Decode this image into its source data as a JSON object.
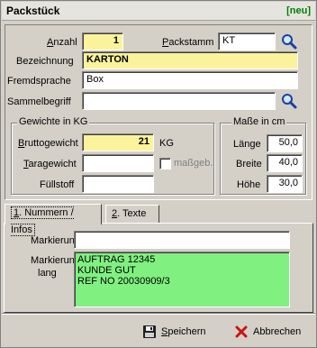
{
  "window": {
    "title": "Packstück",
    "badge": "[neu]",
    "badge_color": "#008000"
  },
  "main": {
    "anzahl": {
      "label_u": "A",
      "label_rest": "nzahl",
      "value": "1"
    },
    "packstamm": {
      "label_u": "P",
      "label_rest": "ackstamm",
      "value": "KT"
    },
    "bezeichnung": {
      "label": "Bezeichnung",
      "value": "KARTON"
    },
    "fremdsprache": {
      "label": "Fremdsprache",
      "value": "Box"
    },
    "sammelbegriff": {
      "label": "Sammelbegriff",
      "value": ""
    }
  },
  "weights": {
    "title": "Gewichte in KG",
    "brutto": {
      "label_u": "B",
      "label_rest": "ruttogewicht",
      "value": "21",
      "unit": "KG"
    },
    "tara": {
      "label_u": "T",
      "label_rest": "aragewicht",
      "value": ""
    },
    "tara_checkbox_label": "maßgeb.",
    "fuellstoff": {
      "label": "Füllstoff",
      "value": ""
    }
  },
  "dimensions": {
    "title": "Maße in cm",
    "laenge": {
      "label": "Länge",
      "value": "50,0"
    },
    "breite": {
      "label": "Breite",
      "value": "40,0"
    },
    "hoehe": {
      "label": "Höhe",
      "value": "30,0"
    }
  },
  "tabs": [
    {
      "label_u": "1",
      "label_rest": ". Nummern / Infos"
    },
    {
      "label_u": "2",
      "label_rest": ". Texte"
    }
  ],
  "tab_content": {
    "markierung": {
      "label": "Markierung",
      "value": ""
    },
    "markierung_lang": {
      "label_line1": "Markierung",
      "label_line2": "lang",
      "lines": [
        "AUFTRAG 12345",
        "KUNDE GUT",
        "REF NO 20030909/3"
      ]
    }
  },
  "buttons": {
    "save_u": "S",
    "save_rest": "peichern",
    "cancel": "Abbrechen"
  },
  "colors": {
    "required_field": "#fbf39b",
    "marking_field": "#80f080",
    "search_icon": "#1c3fa0",
    "cancel_icon": "#c81414"
  }
}
